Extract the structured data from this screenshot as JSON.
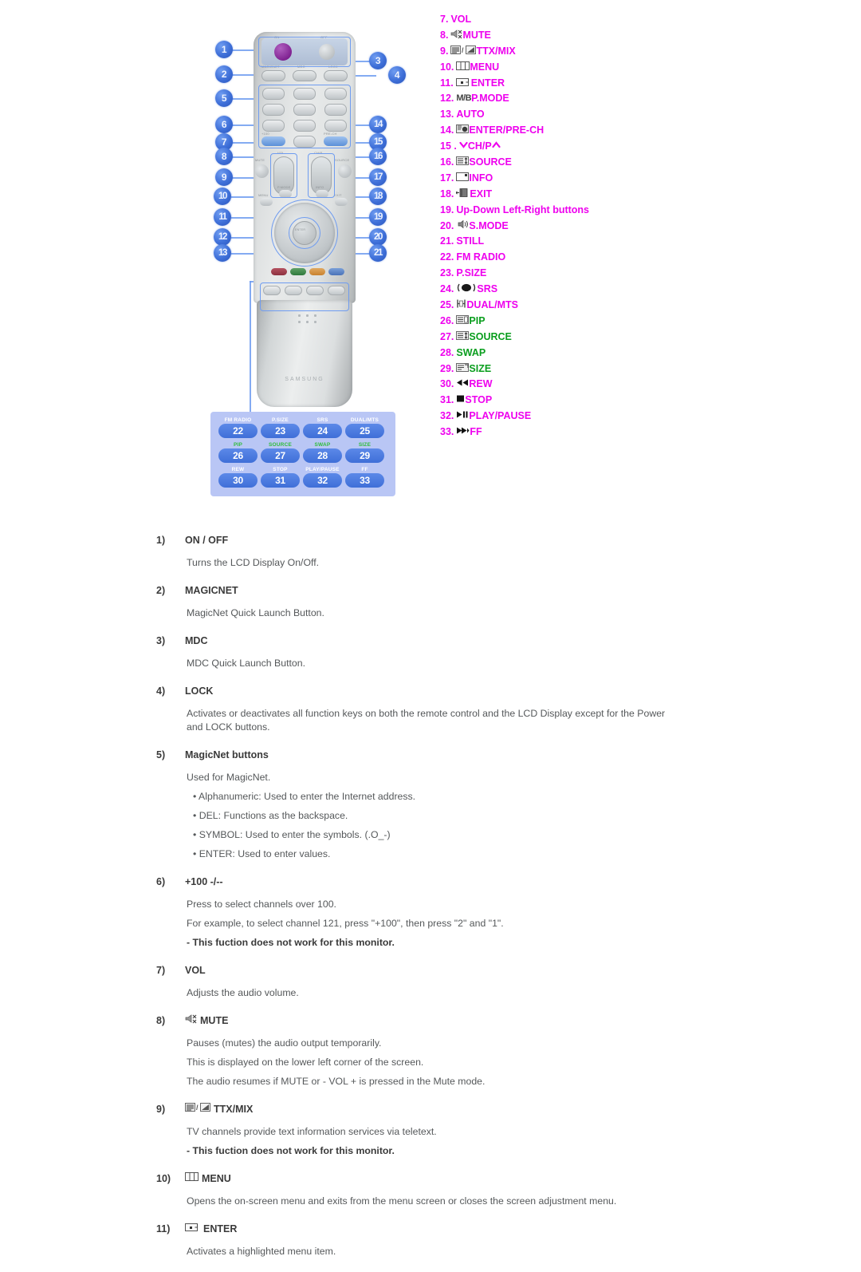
{
  "legend": {
    "items": [
      {
        "num": "7.",
        "icon": "none",
        "label": "VOL",
        "color": "magenta"
      },
      {
        "num": "8.",
        "icon": "mute-icon",
        "label": "MUTE",
        "color": "magenta"
      },
      {
        "num": "9.",
        "icon": "ttx-mix-icon",
        "label": "TTX/MIX",
        "color": "magenta"
      },
      {
        "num": "10.",
        "icon": "menu-icon",
        "label": "MENU",
        "color": "magenta"
      },
      {
        "num": "11.",
        "icon": "enter-icon",
        "label": "ENTER",
        "color": "magenta"
      },
      {
        "num": "12.",
        "icon": "mb-icon",
        "label": "P.MODE",
        "color": "magenta"
      },
      {
        "num": "13.",
        "icon": "none",
        "label": "AUTO",
        "color": "magenta"
      },
      {
        "num": "14.",
        "icon": "pre-ch-icon",
        "label": "ENTER/PRE-CH",
        "color": "magenta"
      },
      {
        "num": "15 .",
        "icon": "chevron-down-icon",
        "label": "CH/P",
        "color": "magenta",
        "trailing_icon": "chevron-up-icon"
      },
      {
        "num": "16.",
        "icon": "source-icon",
        "label": "SOURCE",
        "color": "magenta"
      },
      {
        "num": "17.",
        "icon": "info-icon",
        "label": "INFO",
        "color": "magenta"
      },
      {
        "num": "18.",
        "icon": "exit-icon",
        "label": "EXIT",
        "color": "magenta"
      },
      {
        "num": "19.",
        "icon": "none",
        "label": "Up-Down Left-Right buttons",
        "color": "magenta"
      },
      {
        "num": "20.",
        "icon": "s-mode-icon",
        "label": "S.MODE",
        "color": "magenta"
      },
      {
        "num": "21.",
        "icon": "none",
        "label": "STILL",
        "color": "magenta"
      },
      {
        "num": "22.",
        "icon": "none",
        "label": "FM RADIO",
        "color": "magenta"
      },
      {
        "num": "23.",
        "icon": "none",
        "label": "P.SIZE",
        "color": "magenta"
      },
      {
        "num": "24.",
        "icon": "srs-icon",
        "label": "SRS",
        "color": "magenta"
      },
      {
        "num": "25.",
        "icon": "dual-mts-icon",
        "label": "DUAL/MTS",
        "color": "magenta"
      },
      {
        "num": "26.",
        "icon": "pip-icon",
        "label": "PIP",
        "color": "green"
      },
      {
        "num": "27.",
        "icon": "source2-icon",
        "label": "SOURCE",
        "color": "green"
      },
      {
        "num": "28.",
        "icon": "none",
        "label": "SWAP",
        "color": "green"
      },
      {
        "num": "29.",
        "icon": "size-icon",
        "label": "SIZE",
        "color": "green"
      },
      {
        "num": "30.",
        "icon": "rewind-icon",
        "label": "REW",
        "color": "magenta"
      },
      {
        "num": "31.",
        "icon": "stop-icon",
        "label": "STOP",
        "color": "magenta"
      },
      {
        "num": "32.",
        "icon": "play-pause-icon",
        "label": "PLAY/PAUSE",
        "color": "magenta"
      },
      {
        "num": "33.",
        "icon": "ff-icon",
        "label": "FF",
        "color": "magenta"
      }
    ]
  },
  "remote": {
    "brand": "SAMSUNG",
    "callouts_left": [
      "1",
      "2",
      "5",
      "6",
      "7",
      "8",
      "9",
      "10",
      "11",
      "12",
      "13"
    ],
    "callouts_right": [
      "3",
      "4",
      "14",
      "15",
      "16",
      "17",
      "18",
      "19",
      "20",
      "21"
    ],
    "hints": {
      "on": "ON",
      "off": "OFF",
      "magicnet": "MAGICNET",
      "mdc": "MDC",
      "lock": "LOCK",
      "plus100": "+100",
      "pre_ch": "PRE-CH",
      "vol": "VOL",
      "chp": "CH/P",
      "mute": "MUTE",
      "source": "SOURCE",
      "menu": "MENU",
      "exit": "EXIT",
      "info": "INFO",
      "enter": "ENTER",
      "auto": "AUTO",
      "pmode": "P.MODE",
      "smode": "S.MODE",
      "still": "STILL"
    }
  },
  "keypad": {
    "rows": [
      {
        "labels": [
          "FM RADIO",
          "P.SIZE",
          "SRS",
          "DUAL/MTS"
        ],
        "keys": [
          "22",
          "23",
          "24",
          "25"
        ],
        "color": "white"
      },
      {
        "labels": [
          "PIP",
          "SOURCE",
          "SWAP",
          "SIZE"
        ],
        "keys": [
          "26",
          "27",
          "28",
          "29"
        ],
        "color": "green"
      },
      {
        "labels": [
          "REW",
          "STOP",
          "PLAY/PAUSE",
          "FF"
        ],
        "keys": [
          "30",
          "31",
          "32",
          "33"
        ],
        "color": "white"
      }
    ]
  },
  "sections": [
    {
      "num": "1)",
      "icon": "none",
      "title": "ON / OFF",
      "lines": [
        {
          "text": "Turns the LCD Display On/Off.",
          "style": "normal"
        }
      ]
    },
    {
      "num": "2)",
      "icon": "none",
      "title": "MAGICNET",
      "lines": [
        {
          "text": "MagicNet Quick Launch Button.",
          "style": "normal"
        }
      ]
    },
    {
      "num": "3)",
      "icon": "none",
      "title": "MDC",
      "lines": [
        {
          "text": "MDC Quick Launch Button.",
          "style": "normal"
        }
      ]
    },
    {
      "num": "4)",
      "icon": "none",
      "title": "LOCK",
      "lines": [
        {
          "text": "Activates or deactivates all function keys on both the remote control and the LCD Display except for the Power and LOCK buttons.",
          "style": "normal"
        }
      ]
    },
    {
      "num": "5)",
      "icon": "none",
      "title": "MagicNet buttons",
      "lines": [
        {
          "text": "Used for MagicNet.",
          "style": "normal"
        },
        {
          "text": "• Alphanumeric: Used to enter the Internet address.",
          "style": "bullet"
        },
        {
          "text": "• DEL: Functions as the backspace.",
          "style": "bullet"
        },
        {
          "text": "• SYMBOL: Used to enter the symbols. (.O_-)",
          "style": "bullet"
        },
        {
          "text": "• ENTER: Used to enter values.",
          "style": "bullet"
        }
      ]
    },
    {
      "num": "6)",
      "icon": "none",
      "title": "+100 -/--",
      "lines": [
        {
          "text": "Press to select channels over 100.",
          "style": "normal"
        },
        {
          "text": "For example, to select channel 121, press \"+100\", then press \"2\" and \"1\".",
          "style": "normal"
        },
        {
          "text": "- This fuction does not work for this monitor.",
          "style": "bold"
        }
      ]
    },
    {
      "num": "7)",
      "icon": "none",
      "title": "VOL",
      "lines": [
        {
          "text": "Adjusts the audio volume.",
          "style": "normal"
        }
      ]
    },
    {
      "num": "8)",
      "icon": "mute-icon",
      "title": "MUTE",
      "lines": [
        {
          "text": "Pauses (mutes) the audio output temporarily.",
          "style": "normal"
        },
        {
          "text": "This is displayed on the lower left corner of the screen.",
          "style": "normal"
        },
        {
          "text": "The audio resumes if MUTE or - VOL + is pressed in the Mute mode.",
          "style": "normal"
        }
      ]
    },
    {
      "num": "9)",
      "icon": "ttx-mix-icon",
      "title": "TTX/MIX",
      "lines": [
        {
          "text": "TV channels provide text information services via teletext.",
          "style": "normal"
        },
        {
          "text": "- This fuction does not work for this monitor.",
          "style": "bold"
        }
      ]
    },
    {
      "num": "10)",
      "icon": "menu-icon",
      "title": "MENU",
      "lines": [
        {
          "text": "Opens the on-screen menu and exits from the menu screen or closes the screen adjustment menu.",
          "style": "normal"
        }
      ]
    },
    {
      "num": "11)",
      "icon": "enter-icon",
      "title": "ENTER",
      "lines": [
        {
          "text": "Activates a highlighted menu item.",
          "style": "normal"
        }
      ]
    }
  ],
  "colors": {
    "magenta": "#ee00ee",
    "green": "#0a9e1e",
    "callout_blue": "#3e6fd8",
    "keypad_bg": "#b9c6f5",
    "keypad_key": "#4173da",
    "body_text": "#55585a",
    "heading_text": "#3a3a3a"
  }
}
